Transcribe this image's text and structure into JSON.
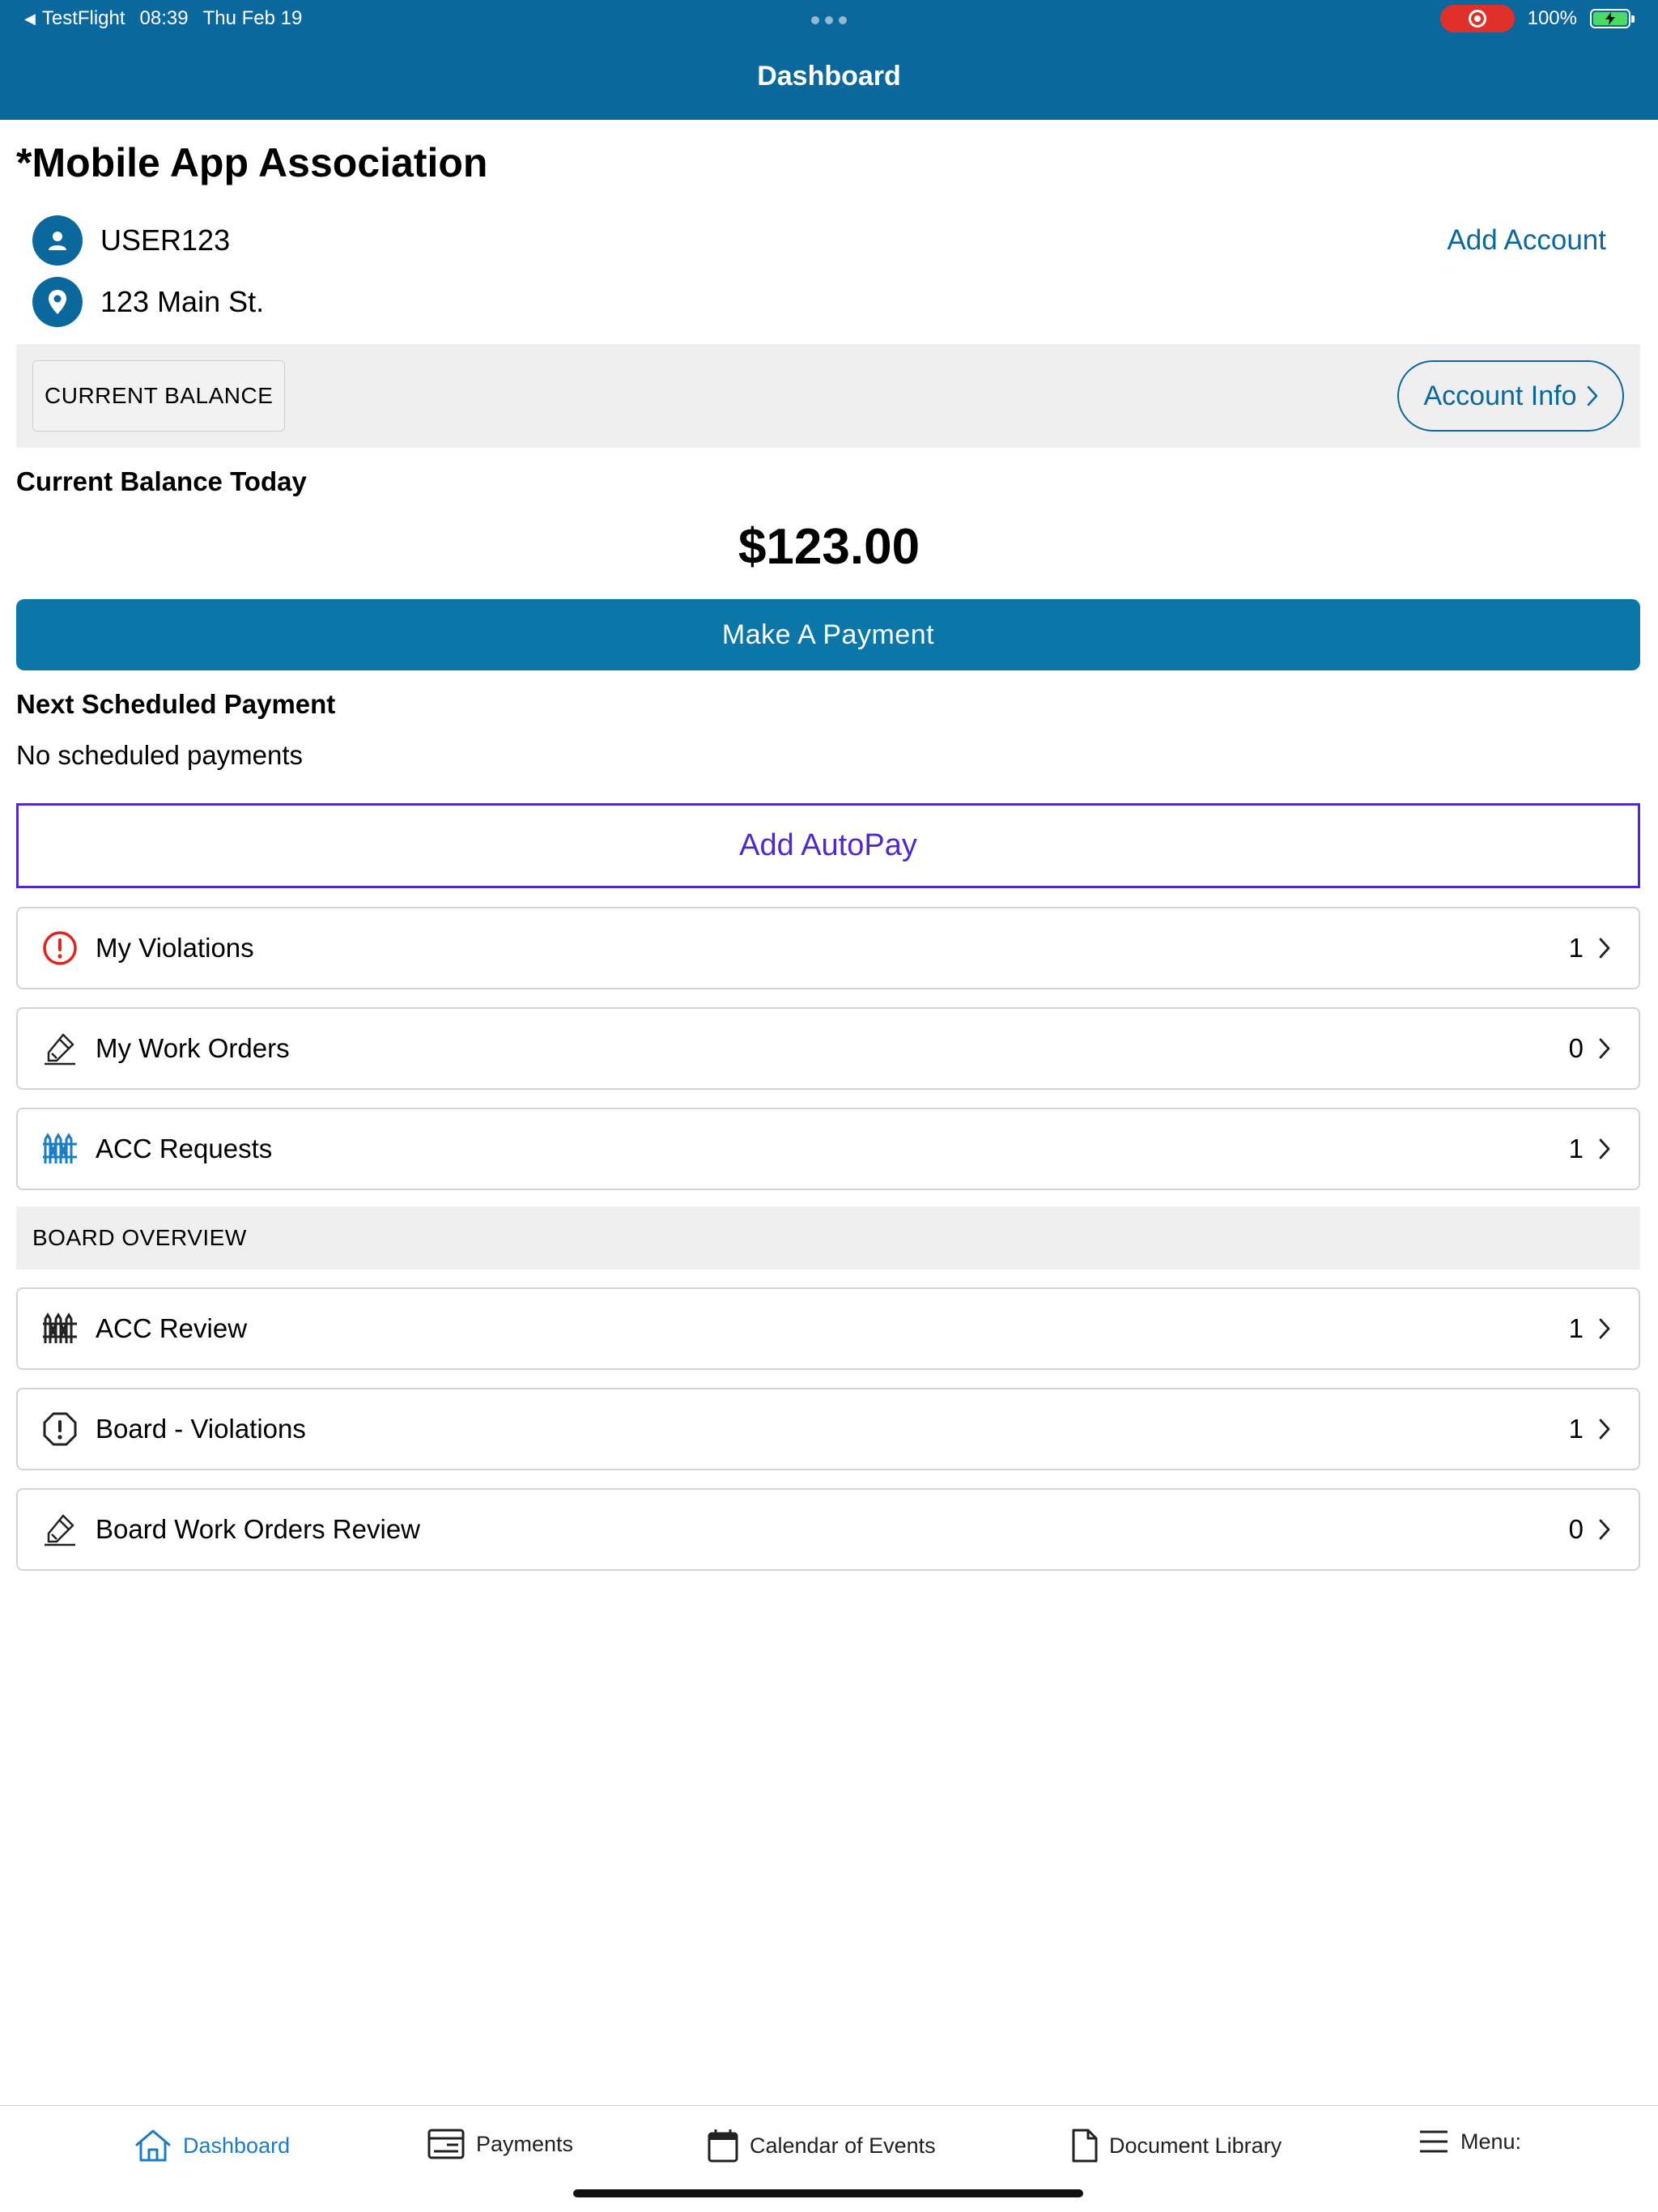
{
  "status_bar": {
    "back_app": "TestFlight",
    "time": "08:39",
    "date": "Thu Feb 19",
    "battery": "100%"
  },
  "header": {
    "title": "Dashboard"
  },
  "association": {
    "name": "*Mobile App Association",
    "user": "USER123",
    "address": "123 Main St.",
    "add_account_label": "Add Account"
  },
  "balance": {
    "chip_label": "CURRENT BALANCE",
    "account_info_label": "Account Info",
    "today_label": "Current Balance Today",
    "amount": "$123.00",
    "make_payment_label": "Make A Payment"
  },
  "scheduled": {
    "title": "Next Scheduled Payment",
    "value": "No scheduled payments",
    "autopay_label": "Add AutoPay"
  },
  "my_items": [
    {
      "label": "My Violations",
      "count": "1",
      "icon": "alert-circle-icon"
    },
    {
      "label": "My Work Orders",
      "count": "0",
      "icon": "work-order-icon"
    },
    {
      "label": "ACC Requests",
      "count": "1",
      "icon": "fence-icon"
    }
  ],
  "board": {
    "section_label": "BOARD OVERVIEW",
    "items": [
      {
        "label": "ACC Review",
        "count": "1",
        "icon": "fence-icon"
      },
      {
        "label": "Board - Violations",
        "count": "1",
        "icon": "alert-octagon-icon"
      },
      {
        "label": "Board Work Orders Review",
        "count": "0",
        "icon": "work-order-icon"
      }
    ]
  },
  "tabs": [
    {
      "label": "Dashboard",
      "icon": "home-icon",
      "active": true
    },
    {
      "label": "Payments",
      "icon": "payments-icon",
      "active": false
    },
    {
      "label": "Calendar of Events",
      "icon": "calendar-icon",
      "active": false
    },
    {
      "label": "Document Library",
      "icon": "document-icon",
      "active": false
    },
    {
      "label": "Menu:",
      "icon": "menu-icon",
      "active": false
    }
  ],
  "colors": {
    "brand": "#0a689c",
    "primary_button": "#0a77a8",
    "autopay": "#5229c9",
    "violation_red": "#e0241b",
    "acc_blue": "#1a7dc0",
    "tab_active": "#1a7dc0"
  }
}
